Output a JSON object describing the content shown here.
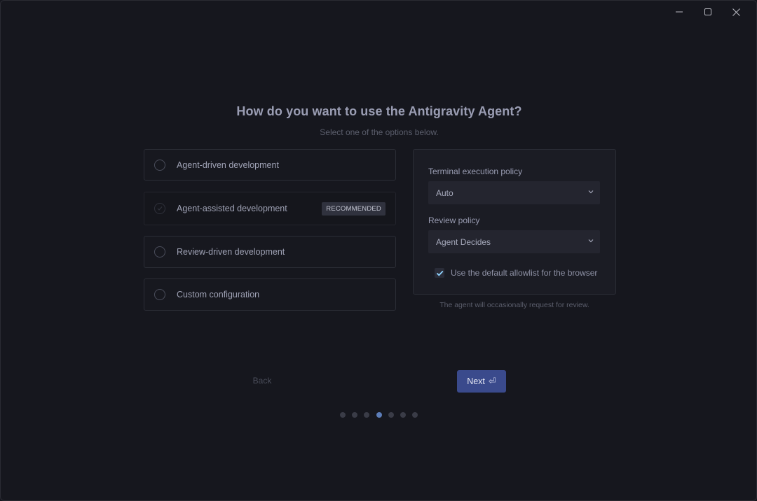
{
  "window_controls": {
    "minimize": "—",
    "maximize": "☐",
    "close": "✕"
  },
  "heading": "How do you want to use the Antigravity Agent?",
  "subheading": "Select one of the options below.",
  "options": [
    {
      "label": "Agent-driven development",
      "selected": false
    },
    {
      "label": "Agent-assisted development",
      "selected": true,
      "badge": "RECOMMENDED"
    },
    {
      "label": "Review-driven development",
      "selected": false
    },
    {
      "label": "Custom configuration",
      "selected": false
    }
  ],
  "panel": {
    "terminal_label": "Terminal execution policy",
    "terminal_value": "Auto",
    "review_label": "Review policy",
    "review_value": "Agent Decides",
    "allowlist_label": "Use the default allowlist for the browser",
    "allowlist_checked": true
  },
  "hint": "The agent will occasionally request for review.",
  "nav": {
    "back_label": "Back",
    "next_label": "Next",
    "next_icon": "⏎"
  },
  "steps": {
    "total": 7,
    "current": 4
  },
  "colors": {
    "accent": "#3a4a8c",
    "active_dot": "#5c7db8",
    "background": "#16171e"
  }
}
